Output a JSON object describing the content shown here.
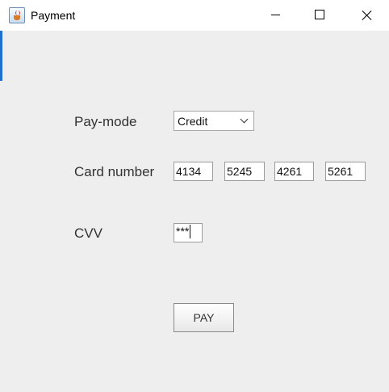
{
  "window": {
    "title": "Payment",
    "icon": "java-app-icon",
    "controls": {
      "minimize": "minimize-icon",
      "maximize": "maximize-icon",
      "close": "close-icon"
    }
  },
  "form": {
    "paymode_label": "Pay-mode",
    "paymode_value": "Credit",
    "card_number_label": "Card number",
    "card_number_segments": [
      "4134",
      "5245",
      "4261",
      "5261"
    ],
    "cvv_label": "CVV",
    "cvv_value": "***",
    "pay_button_label": "PAY"
  },
  "colors": {
    "window_background": "#eeeeee",
    "titlebar_background": "#ffffff",
    "accent": "#1f6fd1"
  }
}
